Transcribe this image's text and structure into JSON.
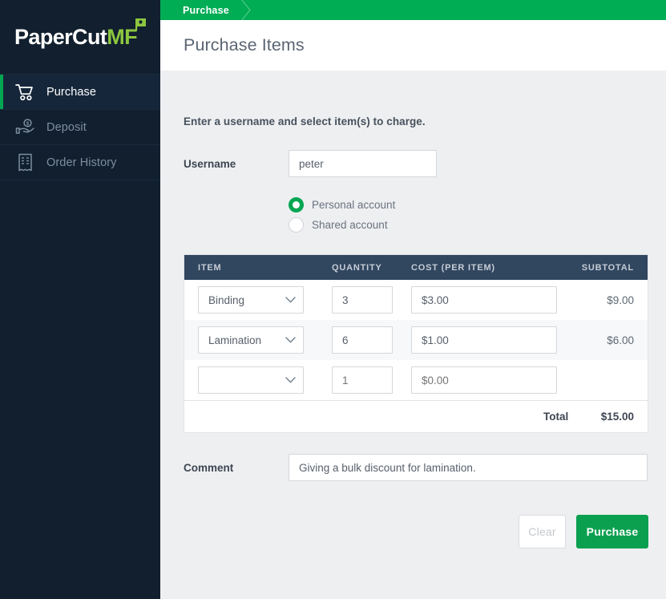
{
  "sidebar": {
    "logo": {
      "primary": "PaperCut",
      "secondary": "MF",
      "flag_icon": "flag-icon"
    },
    "items": [
      {
        "label": "Purchase",
        "icon": "shopping-cart-icon",
        "active": true
      },
      {
        "label": "Deposit",
        "icon": "hand-dollar-icon",
        "active": false
      },
      {
        "label": "Order History",
        "icon": "receipt-icon",
        "active": false
      }
    ]
  },
  "header": {
    "breadcrumb": "Purchase",
    "title": "Purchase Items",
    "bar_color": "#00ac54"
  },
  "main": {
    "intro": "Enter a username and select item(s) to charge.",
    "username": {
      "label": "Username",
      "value": "peter",
      "placeholder": ""
    },
    "account_options": [
      {
        "label": "Personal account",
        "selected": true
      },
      {
        "label": "Shared account",
        "selected": false
      }
    ],
    "table": {
      "columns": [
        "ITEM",
        "QUANTITY",
        "COST (PER ITEM)",
        "SUBTOTAL"
      ],
      "rows": [
        {
          "item": "Binding",
          "quantity": "3",
          "cost": "$3.00",
          "subtotal": "$9.00",
          "placeholder": false
        },
        {
          "item": "Lamination",
          "quantity": "6",
          "cost": "$1.00",
          "subtotal": "$6.00",
          "placeholder": false
        },
        {
          "item": "",
          "quantity": "1",
          "cost": "$0.00",
          "subtotal": "",
          "placeholder": true
        }
      ],
      "total_label": "Total",
      "total_value": "$15.00"
    },
    "comment": {
      "label": "Comment",
      "value": "Giving a bulk discount for lamination.",
      "placeholder": ""
    },
    "buttons": {
      "clear": "Clear",
      "purchase": "Purchase",
      "purchase_color": "#0aa04f"
    }
  }
}
